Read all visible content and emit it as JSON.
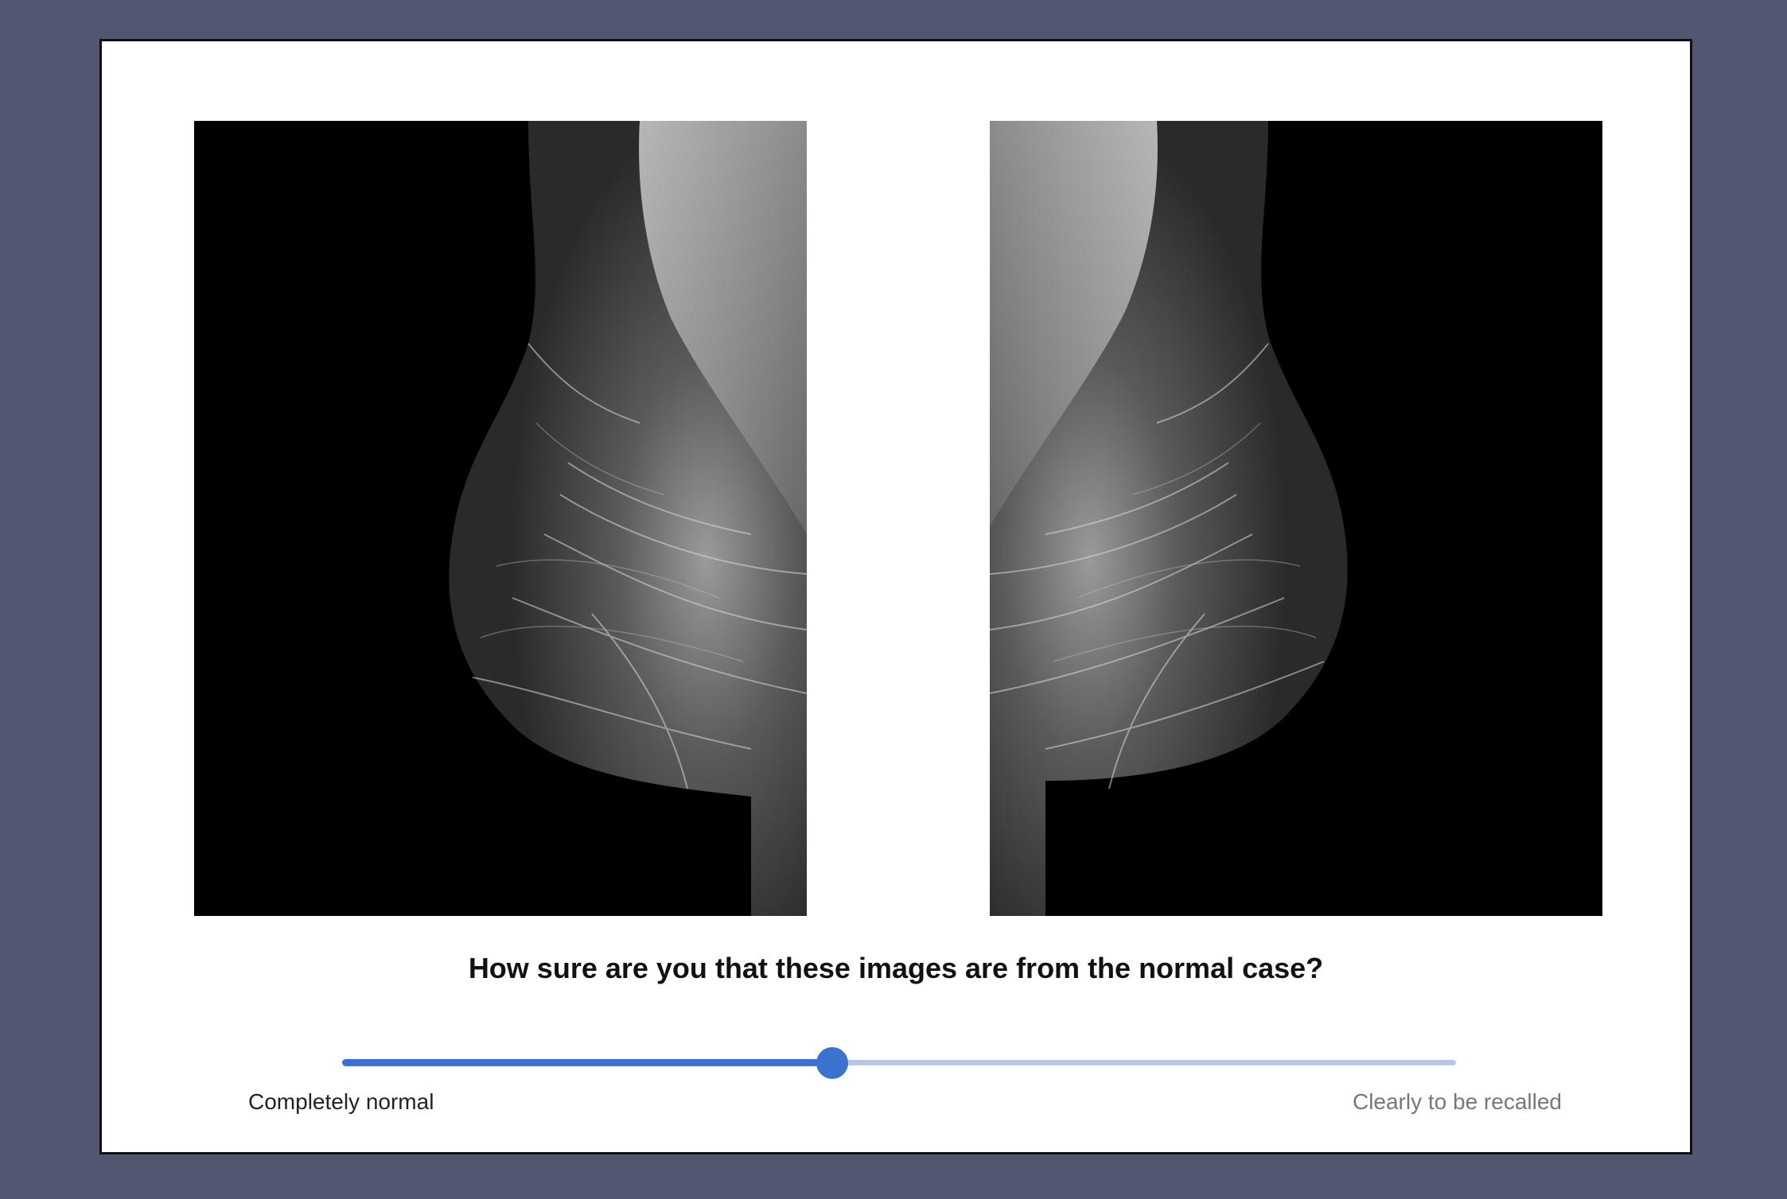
{
  "question": "How sure are you that these images are from the normal case?",
  "slider": {
    "value": 0.44,
    "min_label": "Completely normal",
    "max_label": "Clearly to be recalled"
  },
  "images": [
    {
      "view": "left-mlo",
      "description_icon": "mammogram-image"
    },
    {
      "view": "right-mlo",
      "description_icon": "mammogram-image"
    }
  ],
  "colors": {
    "background": "#525670",
    "card": "#ffffff",
    "slider_fill": "#3b72cf",
    "slider_track": "#b5c8ea"
  }
}
